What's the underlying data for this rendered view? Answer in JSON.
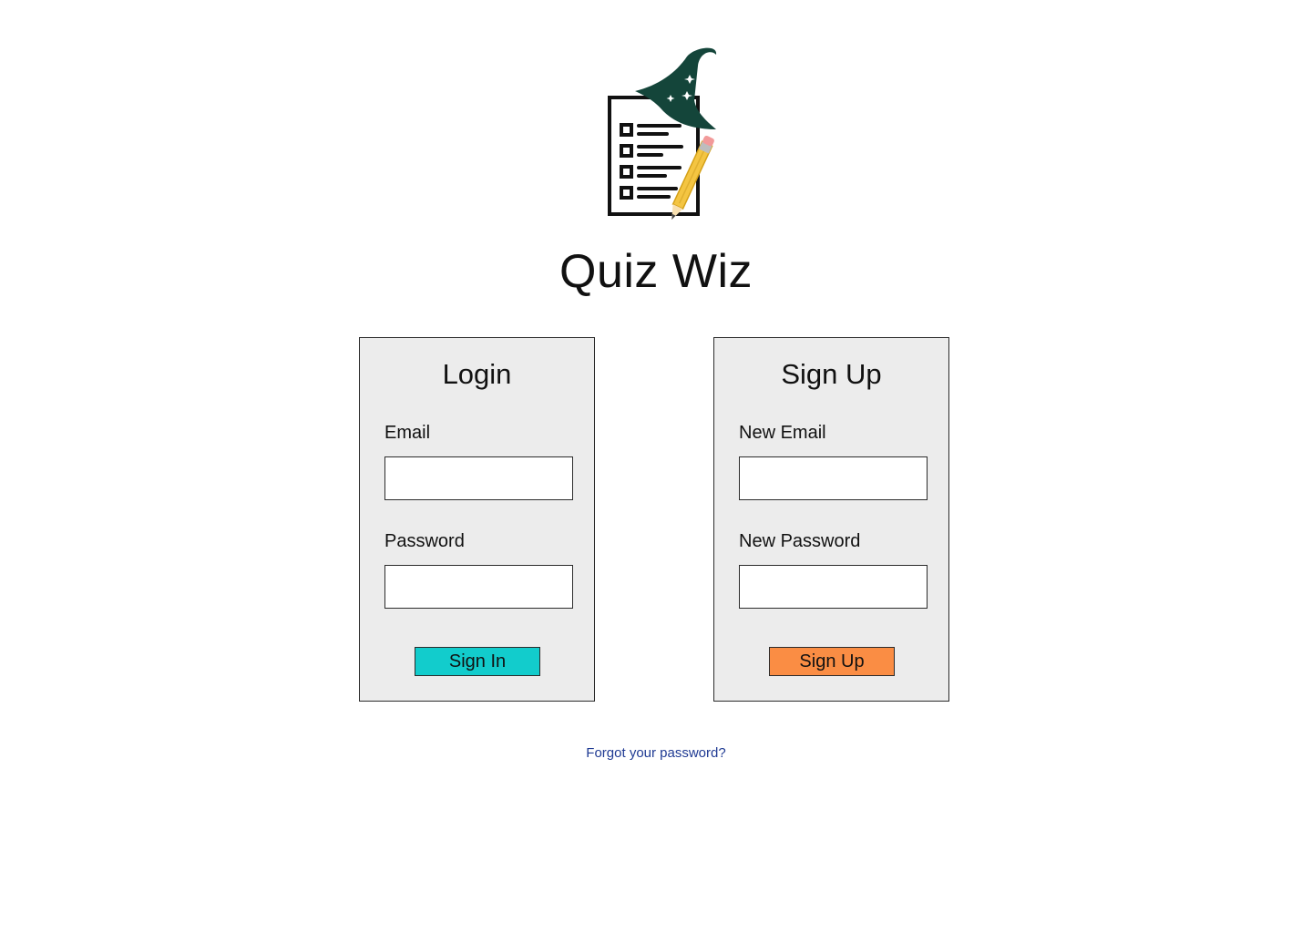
{
  "app": {
    "title": "Quiz Wiz"
  },
  "logo": {
    "icon": "quiz-wizard-logo-icon",
    "colors": {
      "hat": "#14453a",
      "stars": "#ffffff",
      "paper_outline": "#111111",
      "pencil_body": "#f4c542",
      "pencil_eraser": "#f29a9a",
      "pencil_ferrule": "#bdbdbd"
    }
  },
  "login": {
    "title": "Login",
    "email_label": "Email",
    "email_value": "",
    "password_label": "Password",
    "password_value": "",
    "submit_label": "Sign In",
    "submit_color": "#12cccc"
  },
  "signup": {
    "title": "Sign Up",
    "email_label": "New Email",
    "email_value": "",
    "password_label": "New Password",
    "password_value": "",
    "submit_label": "Sign Up",
    "submit_color": "#fa8d44"
  },
  "forgot_password": {
    "label": "Forgot your password?",
    "color": "#1f3a93"
  },
  "colors": {
    "background": "#ffffff",
    "panel_background": "#ececec",
    "border": "#2b2b2b"
  }
}
